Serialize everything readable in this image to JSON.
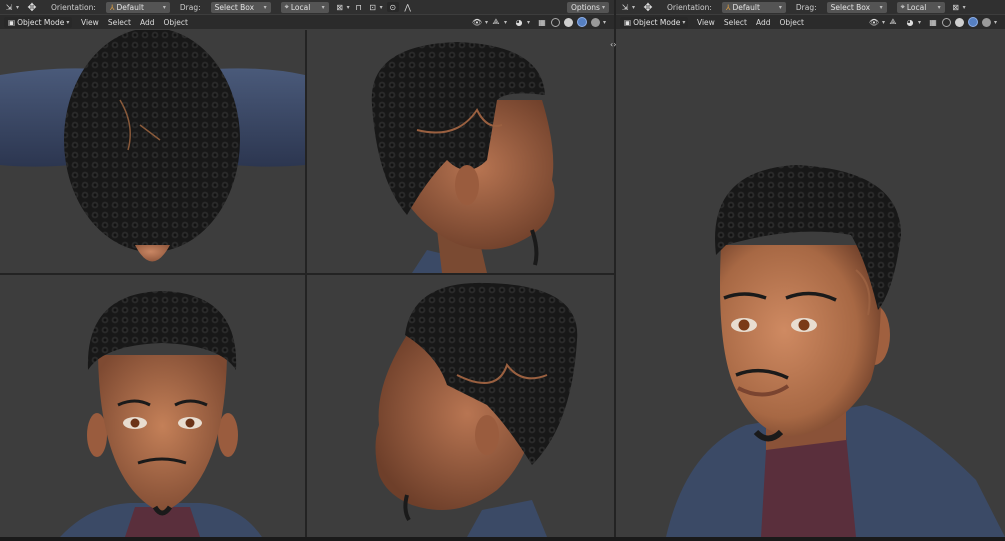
{
  "left_top_header": {
    "orientation_label": "Orientation:",
    "orientation_value": "Default",
    "drag_label": "Drag:",
    "drag_value": "Select Box",
    "pivot_value": "Local",
    "options_label": "Options"
  },
  "left_viewport_header": {
    "mode": "Object Mode",
    "menus": [
      "View",
      "Select",
      "Add",
      "Object"
    ]
  },
  "right_top_header": {
    "orientation_label": "Orientation:",
    "orientation_value": "Default",
    "drag_label": "Drag:",
    "drag_value": "Select Box",
    "pivot_value": "Local"
  },
  "right_viewport_header": {
    "mode": "Object Mode",
    "menus": [
      "View",
      "Select",
      "Add",
      "Object"
    ]
  },
  "colors": {
    "viewport_bg": "#3d3d3d",
    "header_bg": "#303030",
    "skin": "#a86a48",
    "hair": "#1a1a1a",
    "jacket": "#3b4a66",
    "shirt": "#5a2f3c",
    "active_shading": "#5680c2"
  }
}
